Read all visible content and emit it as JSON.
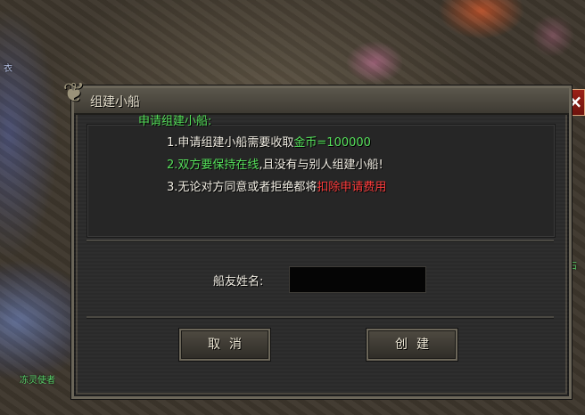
{
  "world": {
    "npc_label_left": "冻灵使者",
    "npc_label_right": "石",
    "overlay_text_left": "衣"
  },
  "dialog": {
    "title": "组建小船",
    "close_label": "×",
    "notice": {
      "heading": "申请组建小船:",
      "line1_prefix": "1.申请组建小船需要收取",
      "line1_highlight": "金币=100000",
      "line2_highlight": "2.双方要保持在线",
      "line2_suffix": ",且没有与别人组建小船!",
      "line3_prefix": "3.无论对方同意或者拒绝都将",
      "line3_highlight": "扣除申请费用"
    },
    "form": {
      "name_label": "船友姓名:",
      "name_value": "",
      "name_placeholder": ""
    },
    "buttons": {
      "cancel": "取消",
      "create": "创建"
    }
  },
  "colors": {
    "highlight_green": "#56e05b",
    "highlight_red": "#ff3c3c",
    "close_red": "#9b2017"
  },
  "icons": {
    "ornament": "dragon-ornament-icon",
    "close": "close-icon"
  }
}
